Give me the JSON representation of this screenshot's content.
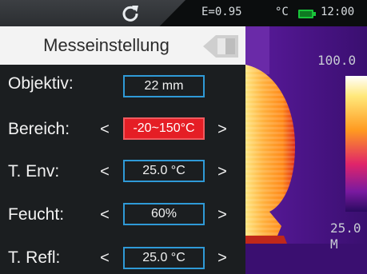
{
  "status_bar": {
    "emissivity": "E=0.95",
    "unit": "°C",
    "time": "12:00",
    "battery_color": "#19c43a"
  },
  "menu": {
    "title": "Messeinstellung",
    "rows": [
      {
        "label": "Objektiv:",
        "value": "22 mm",
        "has_arrows": false,
        "selected": false
      },
      {
        "label": "Bereich:",
        "value": "-20~150°C",
        "has_arrows": true,
        "selected": true
      },
      {
        "label": "T. Env:",
        "value": "25.0 °C",
        "has_arrows": true,
        "selected": false
      },
      {
        "label": "Feucht:",
        "value": "60%",
        "has_arrows": true,
        "selected": false
      },
      {
        "label": "T. Refl:",
        "value": "25.0 °C",
        "has_arrows": true,
        "selected": false
      }
    ],
    "arrow_left": "<",
    "arrow_right": ">",
    "accent_color": "#2f9ad7",
    "selected_color": "#e51e25"
  },
  "thermal": {
    "scale_max": "100.0",
    "readout_line1": "25.0",
    "readout_line2": "M"
  }
}
